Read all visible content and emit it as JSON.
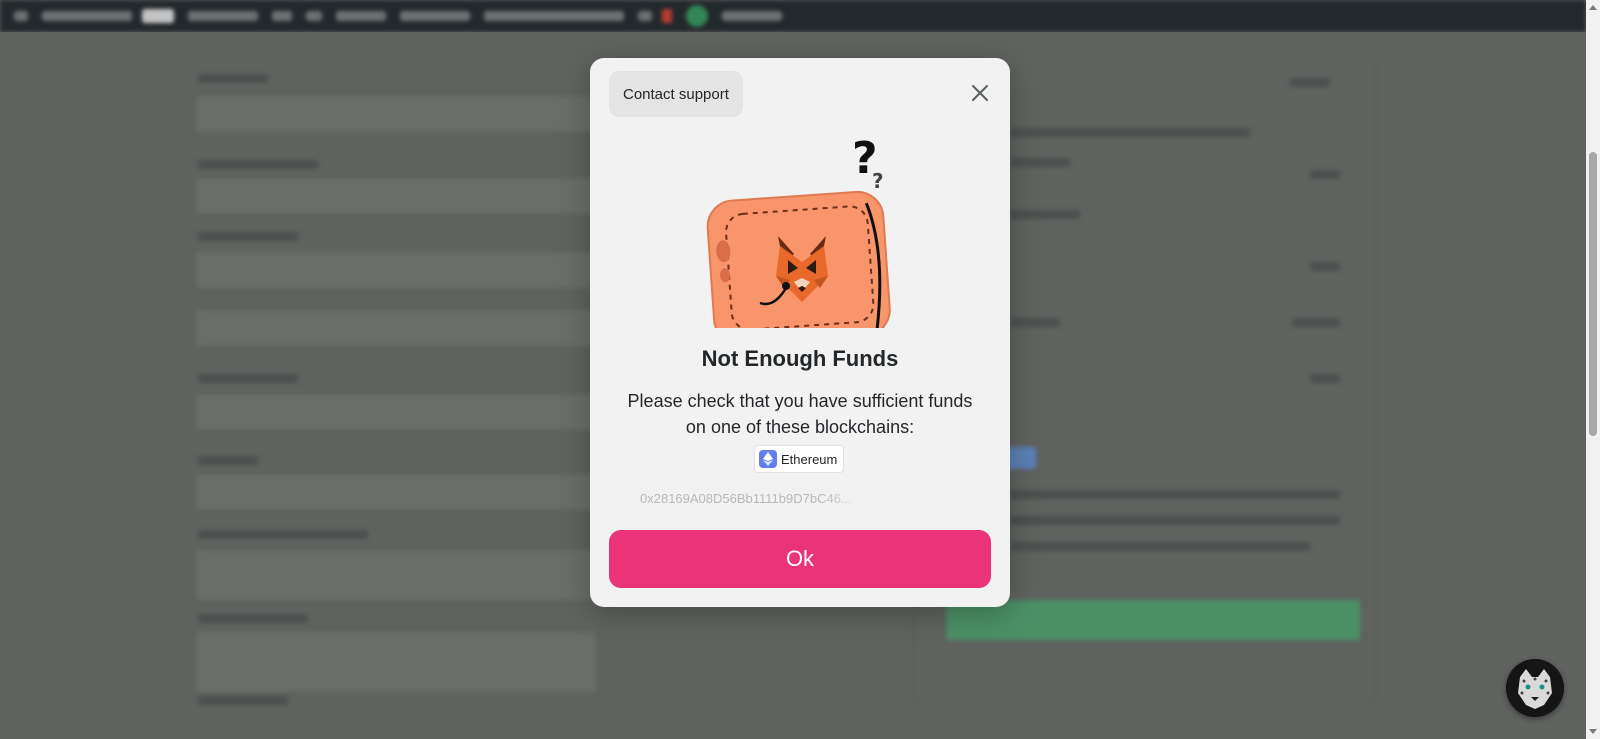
{
  "modal": {
    "support_label": "Contact support",
    "title": "Not Enough Funds",
    "message": "Please check that you have sufficient funds on one of these blockchains:",
    "chain": {
      "name": "Ethereum",
      "icon": "ethereum-icon"
    },
    "address": "0x28169A08D56Bb1111b9D7bC46...",
    "ok_label": "Ok",
    "accent_color": "#ea3379"
  },
  "icons": {
    "close": "close-icon",
    "wallet": "wallet-fox-illustration",
    "avatar": "leopard-avatar"
  }
}
